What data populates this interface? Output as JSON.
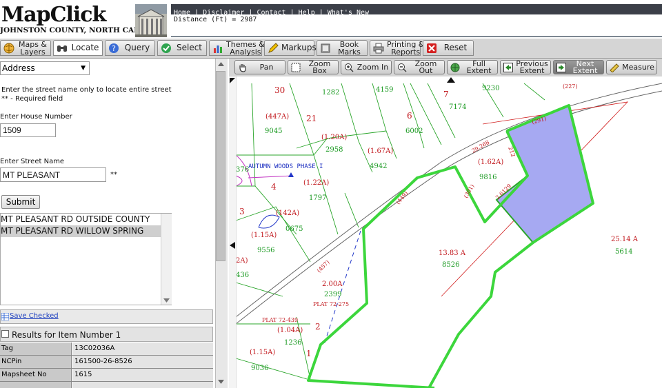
{
  "header": {
    "logo_title": "MapClick",
    "logo_subtitle": "JOHNSTON COUNTY, NORTH CAROLINA",
    "nav": [
      "Home",
      "Disclaimer",
      "Contact",
      "Help",
      "What's New"
    ],
    "distance": "Distance (Ft) = 2987"
  },
  "tabs": [
    {
      "label": "Maps &\nLayers",
      "icon": "globe-icon"
    },
    {
      "label": "Locate",
      "icon": "binoculars-icon"
    },
    {
      "label": "Query",
      "icon": "query-icon"
    },
    {
      "label": "Select",
      "icon": "checkmark-icon"
    },
    {
      "label": "Themes &\nAnalysis",
      "icon": "bar-chart-icon"
    },
    {
      "label": "Markups",
      "icon": "pencil-icon"
    },
    {
      "label": "Book\nMarks",
      "icon": "book-icon"
    },
    {
      "label": "Printing &\nReports",
      "icon": "printer-icon"
    },
    {
      "label": "Reset",
      "icon": "red-x-icon"
    }
  ],
  "locate": {
    "search_type": "Address",
    "instruction_1": "Enter the street name only to locate entire street",
    "instruction_2": "** - Required field",
    "house_label": "Enter House Number",
    "house_value": "1509",
    "street_label": "Enter Street Name",
    "street_value": "MT PLEASANT",
    "required_mark": "**",
    "submit_label": "Submit",
    "results": [
      "MT PLEASANT RD OUTSIDE COUNTY",
      "MT PLEASANT RD WILLOW SPRING"
    ],
    "save_checked": "Save Checked",
    "results_header": "Results for Item Number 1",
    "details": [
      {
        "key": "Tag",
        "value": "13C02036A"
      },
      {
        "key": "NCPin",
        "value": "161500-26-8526"
      },
      {
        "key": "Mapsheet No",
        "value": "1615"
      }
    ]
  },
  "map_tools": [
    {
      "label": "Pan",
      "icon": "hand-icon"
    },
    {
      "label": "Zoom Box",
      "icon": "zoom-box-icon"
    },
    {
      "label": "Zoom In",
      "icon": "zoom-in-icon"
    },
    {
      "label": "Zoom Out",
      "icon": "zoom-out-icon"
    },
    {
      "label": "Full\nExtent",
      "icon": "globe-icon"
    },
    {
      "label": "Previous\nExtent",
      "icon": "arrow-left-icon"
    },
    {
      "label": "Next\nExtent",
      "icon": "arrow-right-icon"
    },
    {
      "label": "Measure",
      "icon": "ruler-icon"
    }
  ],
  "map": {
    "subdivision": "AUTUMN WOODS PHASE I",
    "parcels": [
      {
        "acre": "(447A)",
        "pin": "9045"
      },
      {
        "acre": "(1.20A)",
        "pin": "2958"
      },
      {
        "acre": "(1.67A)",
        "pin": "4942"
      },
      {
        "acre": "(1.22A)",
        "pin": "1797"
      },
      {
        "acre": "(142A)",
        "pin": "0675"
      },
      {
        "acre": "(1.15A)",
        "pin": "9556"
      },
      {
        "acre": "(1.62A)",
        "pin": "9816"
      },
      {
        "acre": "13.83 A",
        "pin": "8526"
      },
      {
        "acre": "25.14 A",
        "pin": "5614"
      },
      {
        "acre": "2.00A",
        "pin": "2399"
      },
      {
        "acre": "(1.04A)",
        "pin": "1236"
      },
      {
        "acre": "(1.15A)",
        "pin": "9036"
      }
    ],
    "pins_plain": [
      "1282",
      "4159",
      "9230",
      "7174",
      "6002",
      "436",
      "376"
    ],
    "lot_numbers": [
      "30",
      "21",
      "7",
      "6",
      "4",
      "3",
      "2",
      "1"
    ],
    "plats": [
      "PLAT 72-275",
      "PLAT 72-439"
    ],
    "road_labels": [
      "(227)",
      "(291)",
      "(449)",
      "(301)",
      "(457)",
      "212",
      "29.268",
      "2.6129"
    ],
    "partial_acre": "2A)"
  },
  "colors": {
    "highlight_outline": "#3cd63c",
    "selection_fill": "#a6a9f2",
    "acre_text": "#c1161b",
    "pin_text": "#1b9a22",
    "parcel_lines": "#2aa52a"
  }
}
